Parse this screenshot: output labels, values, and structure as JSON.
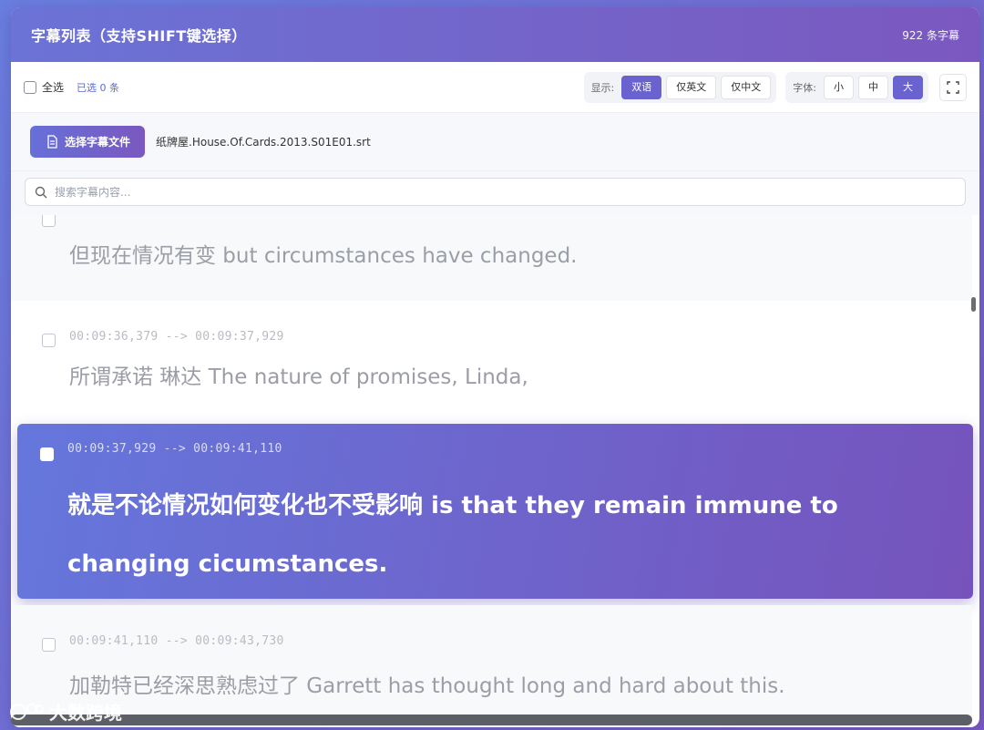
{
  "header": {
    "title": "字幕列表（支持SHIFT键选择）",
    "count": "922 条字幕"
  },
  "toolbar": {
    "select_all": "全选",
    "selected": "已选 0 条",
    "display_label": "显示:",
    "display_options": [
      "双语",
      "仅英文",
      "仅中文"
    ],
    "display_active": "双语",
    "font_label": "字体:",
    "font_options": [
      "小",
      "中",
      "大"
    ],
    "font_active": "大"
  },
  "file": {
    "button_label": "选择字幕文件",
    "filename": "纸牌屋.House.Of.Cards.2013.S01E01.srt"
  },
  "search": {
    "placeholder": "搜索字幕内容..."
  },
  "subtitles": [
    {
      "text": "但现在情况有变 but circumstances have changed."
    },
    {
      "time": "00:09:36,379 --> 00:09:37,929",
      "text": "所谓承诺 琳达 The nature of promises, Linda,"
    },
    {
      "time": "00:09:37,929 --> 00:09:41,110",
      "text": "就是不论情况如何变化也不受影响 is that they remain immune to changing cicumstances.",
      "active": true
    },
    {
      "time": "00:09:41,110 --> 00:09:43,730",
      "text": "加勒特已经深思熟虑过了 Garrett has thought long and hard about this."
    }
  ],
  "watermark": "大数跨境",
  "colors": {
    "accent": "#6a63cf",
    "gradient_start": "#6577dc",
    "gradient_end": "#7653bc"
  }
}
